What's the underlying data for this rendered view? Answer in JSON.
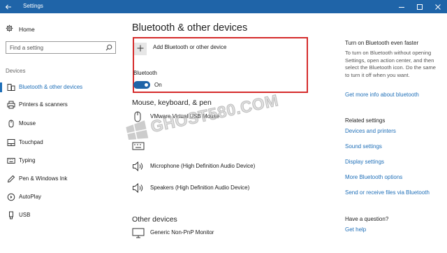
{
  "window": {
    "title": "Settings",
    "back_icon": "back-arrow-icon",
    "controls": [
      "minimize-icon",
      "maximize-icon",
      "close-icon"
    ]
  },
  "sidebar": {
    "home_label": "Home",
    "search_placeholder": "Find a setting",
    "section_label": "Devices",
    "items": [
      {
        "label": "Bluetooth & other devices",
        "icon": "bluetooth-devices-icon",
        "active": true
      },
      {
        "label": "Printers & scanners",
        "icon": "printer-icon"
      },
      {
        "label": "Mouse",
        "icon": "mouse-icon"
      },
      {
        "label": "Touchpad",
        "icon": "touchpad-icon"
      },
      {
        "label": "Typing",
        "icon": "keyboard-icon"
      },
      {
        "label": "Pen & Windows Ink",
        "icon": "pen-icon"
      },
      {
        "label": "AutoPlay",
        "icon": "autoplay-icon"
      },
      {
        "label": "USB",
        "icon": "usb-icon"
      }
    ]
  },
  "main": {
    "title": "Bluetooth & other devices",
    "add_device_label": "Add Bluetooth or other device",
    "bluetooth_label": "Bluetooth",
    "bluetooth_state": "On",
    "sections": [
      {
        "heading": "Mouse, keyboard, & pen",
        "devices": [
          {
            "label": "VMware Virtual USB Mouse",
            "icon": "mouse-icon"
          },
          {
            "label": "",
            "icon": "keyboard-icon"
          }
        ]
      },
      {
        "heading": "",
        "devices": [
          {
            "label": "Microphone (High Definition Audio Device)",
            "icon": "speaker-icon"
          },
          {
            "label": "Speakers (High Definition Audio Device)",
            "icon": "speaker-icon"
          }
        ]
      },
      {
        "heading": "Other devices",
        "devices": [
          {
            "label": "Generic Non-PnP Monitor",
            "icon": "monitor-icon"
          }
        ]
      }
    ]
  },
  "watermark": {
    "text": "GHOST580.COM"
  },
  "right_panel": {
    "tip_heading": "Turn on Bluetooth even faster",
    "tip_text": "To turn on Bluetooth without opening Settings, open action center, and then select the Bluetooth icon. Do the same to turn it off when you want.",
    "tip_link": "Get more info about bluetooth",
    "related_heading": "Related settings",
    "related_links": [
      "Devices and printers",
      "Sound settings",
      "Display settings",
      "More Bluetooth options",
      "Send or receive files via Bluetooth"
    ],
    "question_heading": "Have a question?",
    "help_link": "Get help"
  },
  "colors": {
    "titlebar": "#1f64a8",
    "accent": "#1f6fb8",
    "highlight_border": "#d52b2b"
  }
}
